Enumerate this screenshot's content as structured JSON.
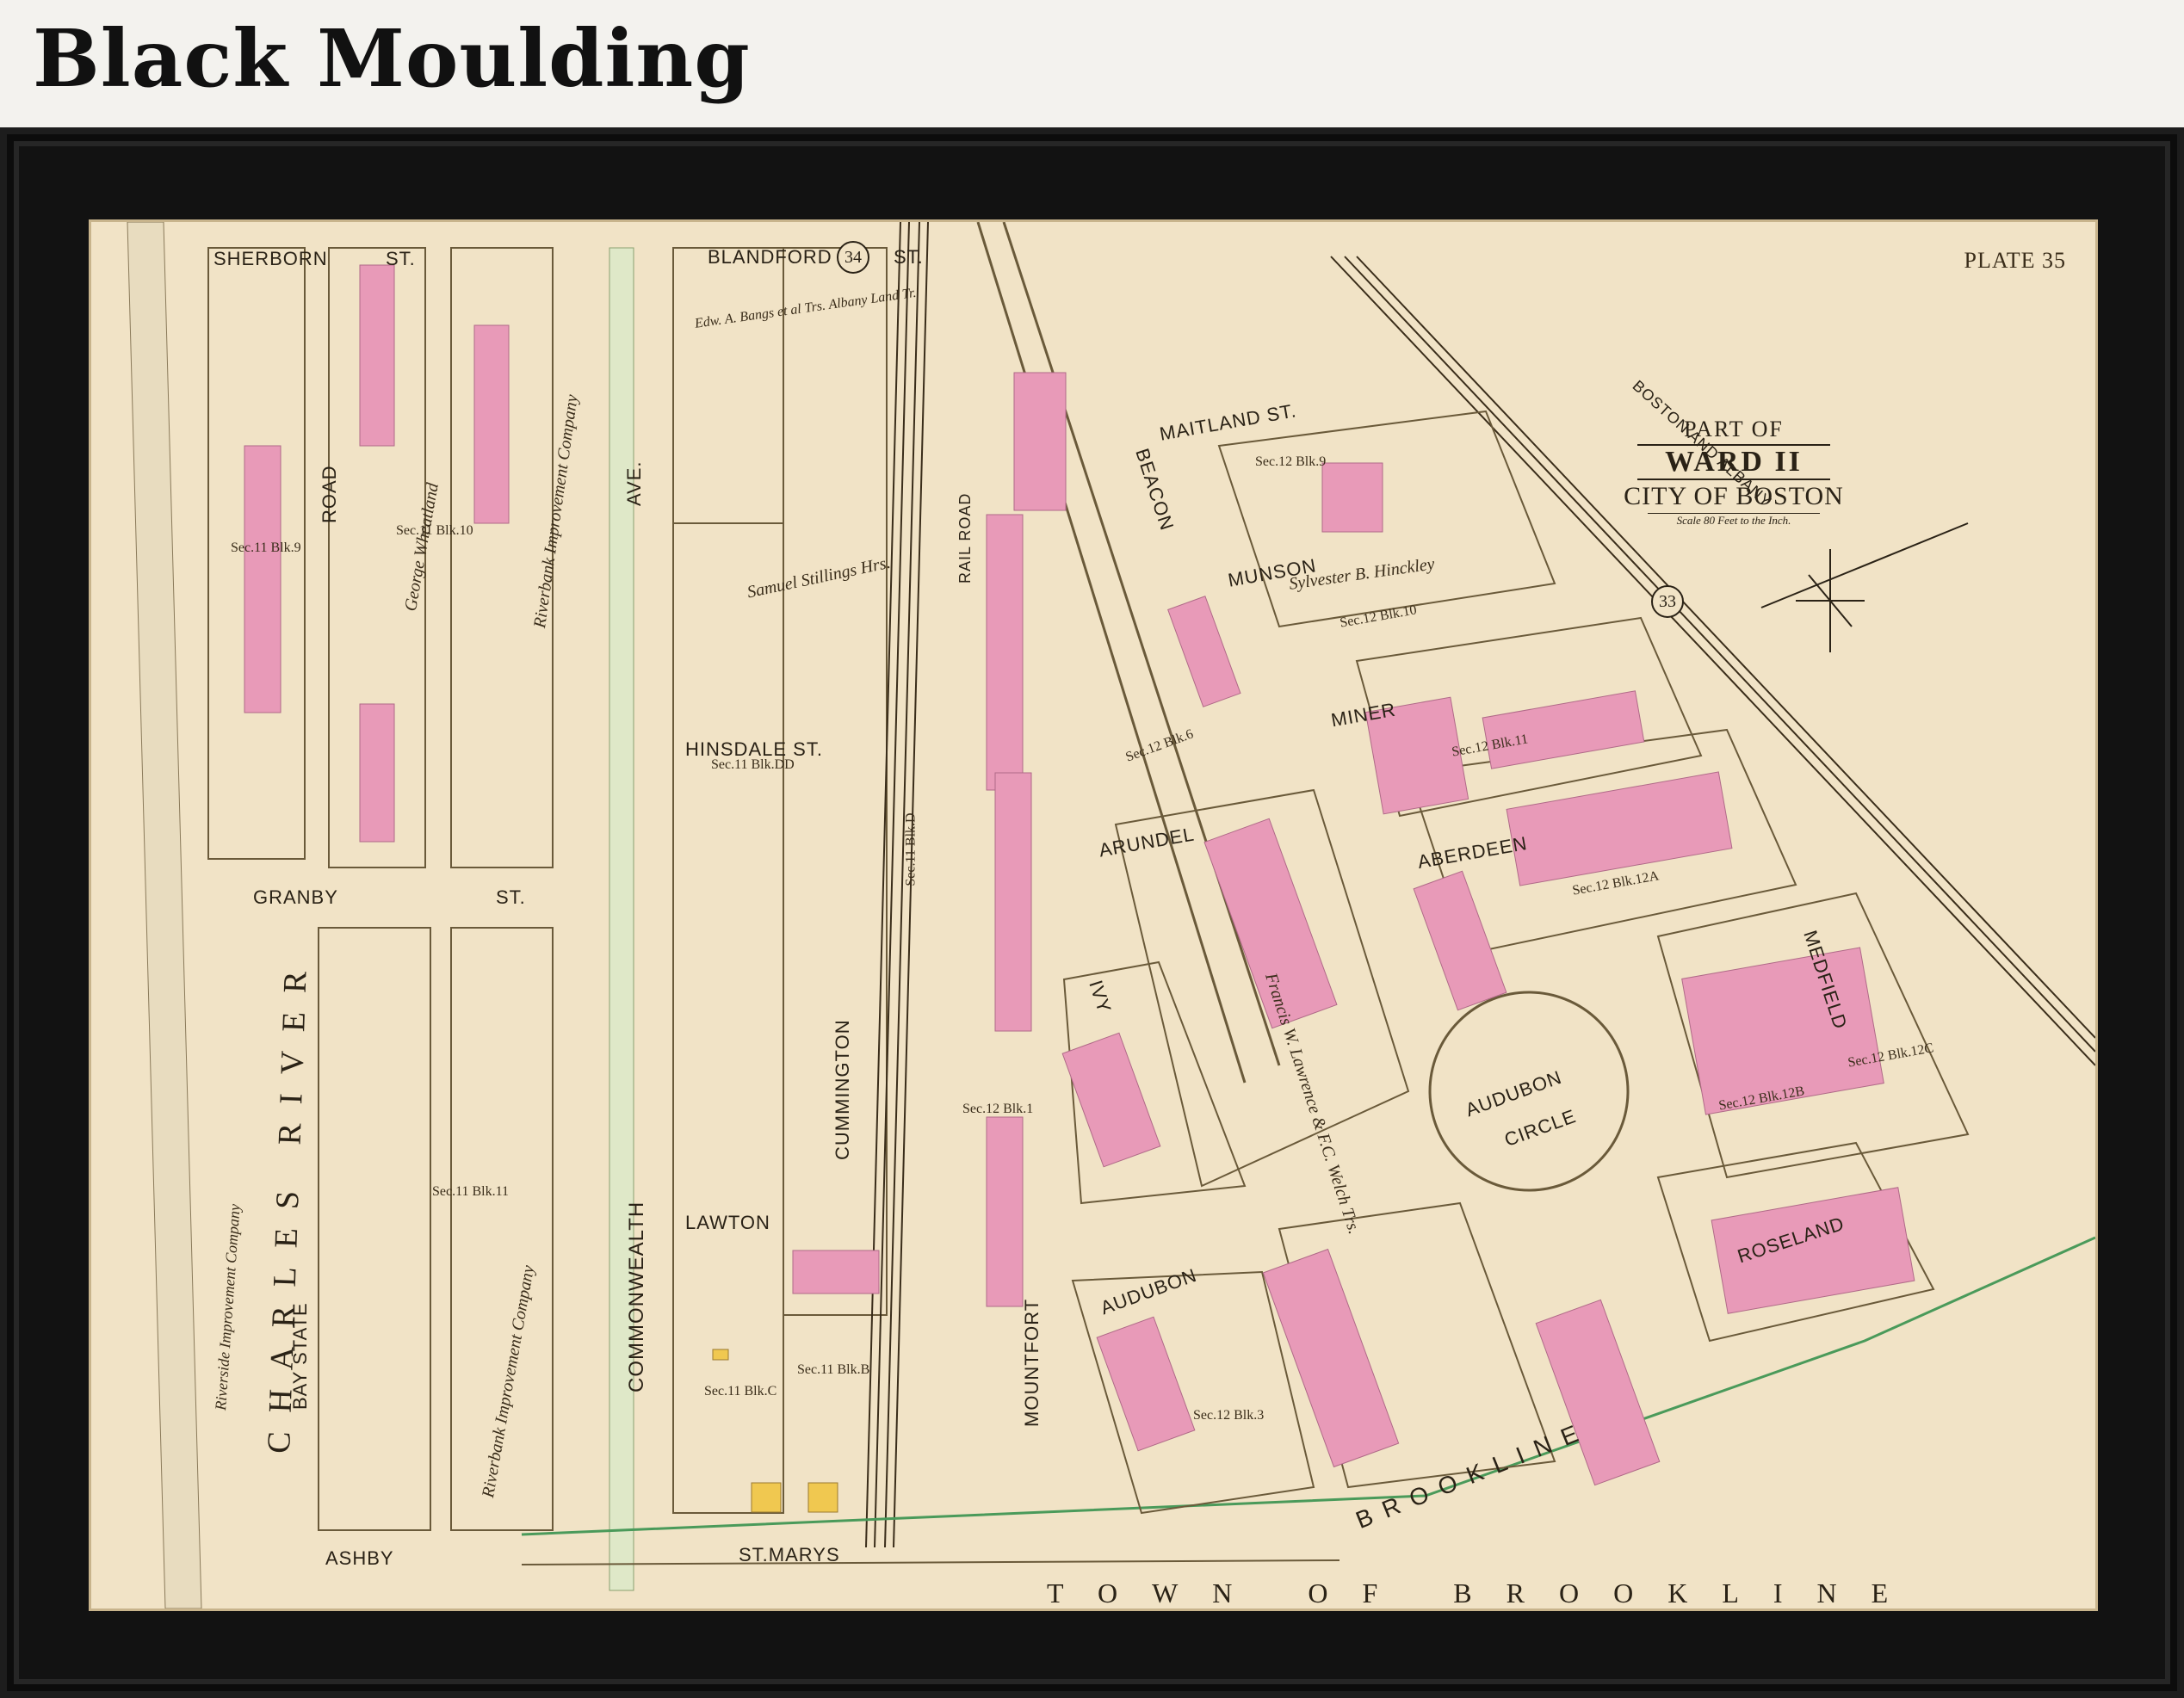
{
  "heading": "Black Moulding",
  "map": {
    "plate": "PLATE 35",
    "cartouche": {
      "line1": "PART OF",
      "line2": "WARD II",
      "line3": "CITY OF BOSTON",
      "line4": "Scale 80 Feet to the Inch."
    },
    "plate_numbers": [
      "34",
      "33"
    ],
    "streets": {
      "sherborn": "SHERBORN",
      "st": "ST.",
      "blandford": "BLANDFORD",
      "road": "ROAD",
      "ave": "AVE.",
      "commonwealth": "COMMONWEALTH",
      "granby": "GRANBY",
      "bay_state": "BAY STATE",
      "ashby": "ASHBY",
      "st_marys": "ST.MARYS",
      "hinsdale": "HINSDALE ST.",
      "cummington": "CUMMINGTON",
      "lawton": "LAWTON",
      "mountfort": "MOUNTFORT",
      "beacon": "BEACON",
      "maitland": "MAITLAND ST.",
      "munson": "MUNSON",
      "miner": "MINER",
      "arundel": "ARUNDEL",
      "aberdeen": "ABERDEEN",
      "ivy": "IVY",
      "audubon": "AUDUBON",
      "audubon_circle_1": "AUDUBON",
      "audubon_circle_2": "CIRCLE",
      "medfield": "MEDFIELD",
      "roseland": "ROSELAND",
      "brookline": "BROOKLINE",
      "rail_road": "RAIL ROAD",
      "boston_albany": "BOSTON AND ALBANY"
    },
    "river": "CHARLES RIVER",
    "town": "TOWN OF BROOKLINE",
    "sections": [
      "Sec.11 Blk.9",
      "Sec.11 Blk.10",
      "Sec.11 Blk.11",
      "Sec.11 Blk.DD",
      "Sec.11 Blk.D",
      "Sec.11 Blk.C",
      "Sec.11 Blk.B",
      "Sec.12 Blk.1",
      "Sec.12 Blk.3",
      "Sec.12 Blk.6",
      "Sec.12 Blk.9",
      "Sec.12 Blk.10",
      "Sec.12 Blk.11",
      "Sec.12 Blk.12A",
      "Sec.12 Blk.12B",
      "Sec.12 Blk.12C"
    ],
    "owners": {
      "wheatland": "George Wheatland",
      "riverbank": "Riverbank Improvement Company",
      "stillings": "Samuel Stillings Hrs.",
      "lawrence": "Francis W. Lawrence & F.C. Welch Trs.",
      "hinckley": "Sylvester B. Hinckley",
      "riverside": "Riverside Improvement Company",
      "bangs": "Edw. A. Bangs et al Trs. Albany Land Tr."
    }
  }
}
